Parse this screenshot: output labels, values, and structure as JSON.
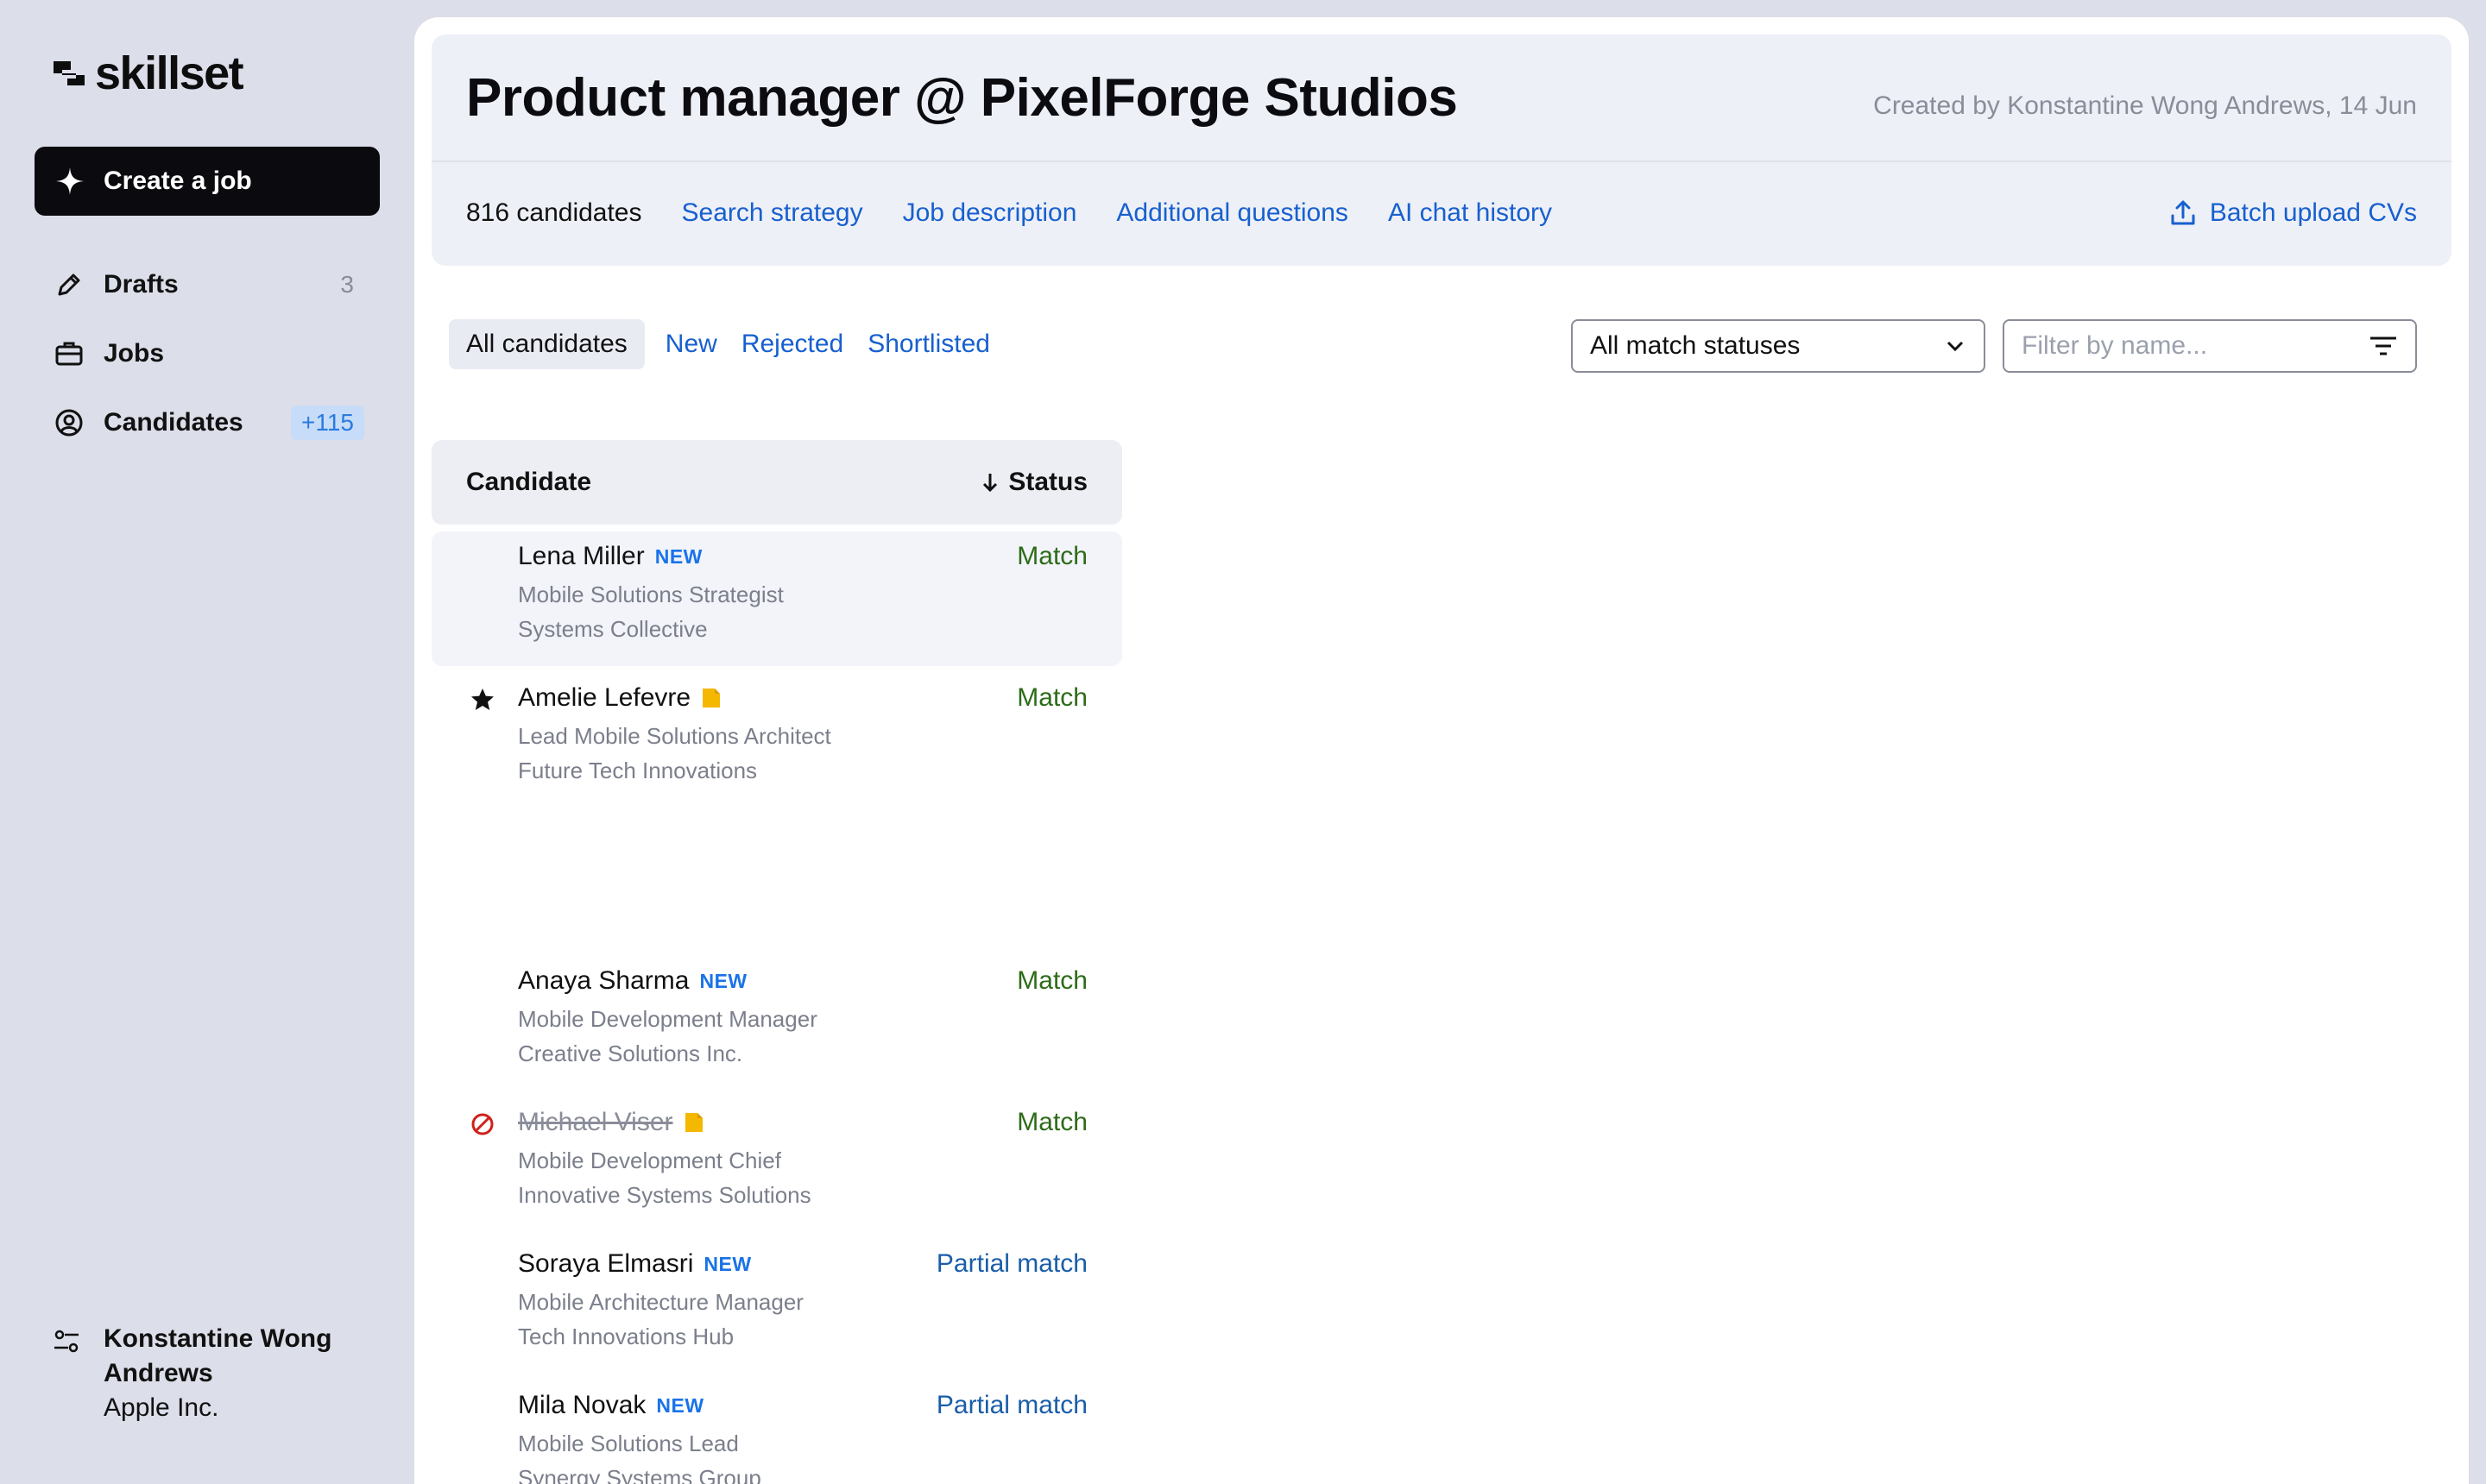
{
  "sidebar": {
    "logo_text": "skillset",
    "create_label": "Create a job",
    "nav": [
      {
        "label": "Drafts",
        "count": "3"
      },
      {
        "label": "Jobs"
      },
      {
        "label": "Candidates",
        "badge": "+115"
      }
    ],
    "profile": {
      "name": "Konstantine Wong Andrews",
      "org": "Apple Inc."
    }
  },
  "header": {
    "title": "Product manager @ PixelForge Studios",
    "created_by": "Created by Konstantine Wong Andrews, 14 Jun",
    "candidate_count": "816 candidates",
    "links": [
      "Search strategy",
      "Job description",
      "Additional questions",
      "AI chat history"
    ],
    "batch_upload": "Batch upload CVs"
  },
  "filters": {
    "tabs": [
      "All candidates",
      "New",
      "Rejected",
      "Shortlisted"
    ],
    "status_select": "All match statuses",
    "name_placeholder": "Filter by name..."
  },
  "table": {
    "col_candidate": "Candidate",
    "col_status": "Status",
    "rows": [
      {
        "name": "Lena Miller",
        "tag": "NEW",
        "role": "Mobile Solutions Strategist",
        "company": "Systems Collective",
        "status": "Match"
      },
      {
        "name": "Amelie Lefevre",
        "role": "Lead Mobile Solutions Architect",
        "company": "Future Tech Innovations",
        "status": "Match"
      },
      {
        "name": "Anaya Sharma",
        "tag": "NEW",
        "role": "Mobile Development Manager",
        "company": "Creative Solutions Inc.",
        "status": "Match"
      },
      {
        "name": "Michael Viser",
        "role": "Mobile Development Chief",
        "company": "Innovative Systems Solutions",
        "status": "Match"
      },
      {
        "name": "Soraya Elmasri",
        "tag": "NEW",
        "role": "Mobile Architecture Manager",
        "company": "Tech Innovations Hub",
        "status": "Partial match"
      },
      {
        "name": "Mila Novak",
        "tag": "NEW",
        "role": "Mobile Solutions Lead",
        "company": "Synergy Systems Group",
        "status": "Partial match"
      }
    ]
  },
  "colors": {
    "link": "#1760cf",
    "match": "#2d6b18",
    "partial": "#1a5da8",
    "note": "#f5b800",
    "rejected": "#d0211b"
  }
}
